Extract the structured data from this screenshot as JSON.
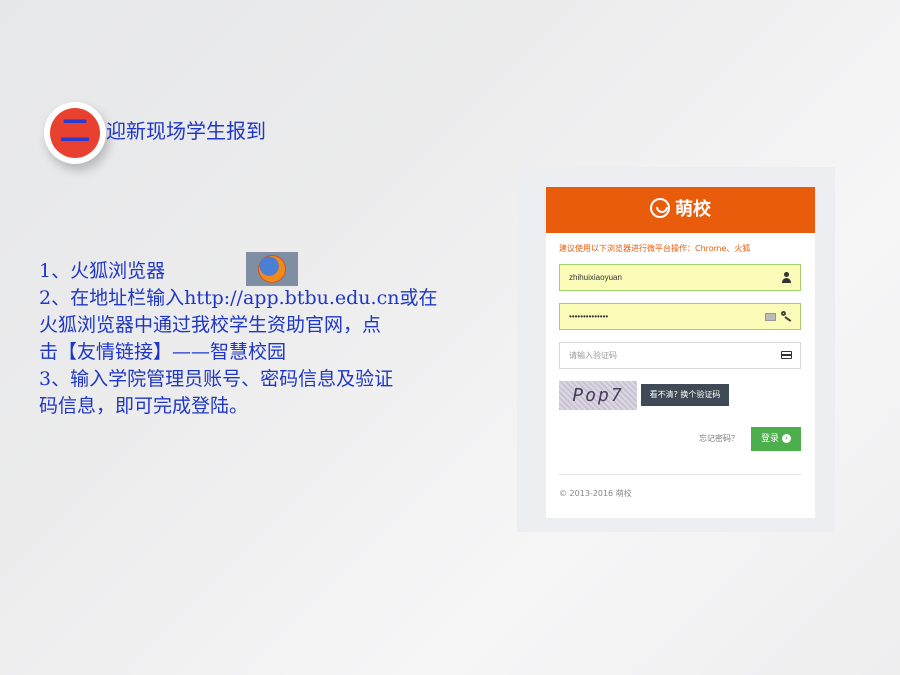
{
  "section": {
    "badge": "二",
    "title": "迎新现场学生报到"
  },
  "instructions": {
    "lines": [
      "1、火狐浏览器",
      "2、在地址栏输入http://app.btbu.edu.cn或在",
      "火狐浏览器中通过我校学生资助官网，点",
      "击【友情链接】——智慧校园",
      "3、输入学院管理员账号、密码信息及验证",
      "码信息，即可完成登陆。"
    ],
    "browser_icon": "firefox-icon"
  },
  "login": {
    "brand": "萌校",
    "notice": "建议使用以下浏览器进行微平台操作：Chrome、火狐",
    "username_value": "zhihuixiaoyuan",
    "password_value": "••••••••••••••",
    "captcha_placeholder": "请输入验证码",
    "captcha_text": "Pop7",
    "refresh_label": "看不清? 换个验证码",
    "forgot_label": "忘记密码？",
    "login_label": "登录",
    "copyright": "© 2013-2016 萌校",
    "colors": {
      "header": "#e85c0c",
      "login_button": "#4cae4c",
      "field_fill": "#fafcb8"
    }
  }
}
